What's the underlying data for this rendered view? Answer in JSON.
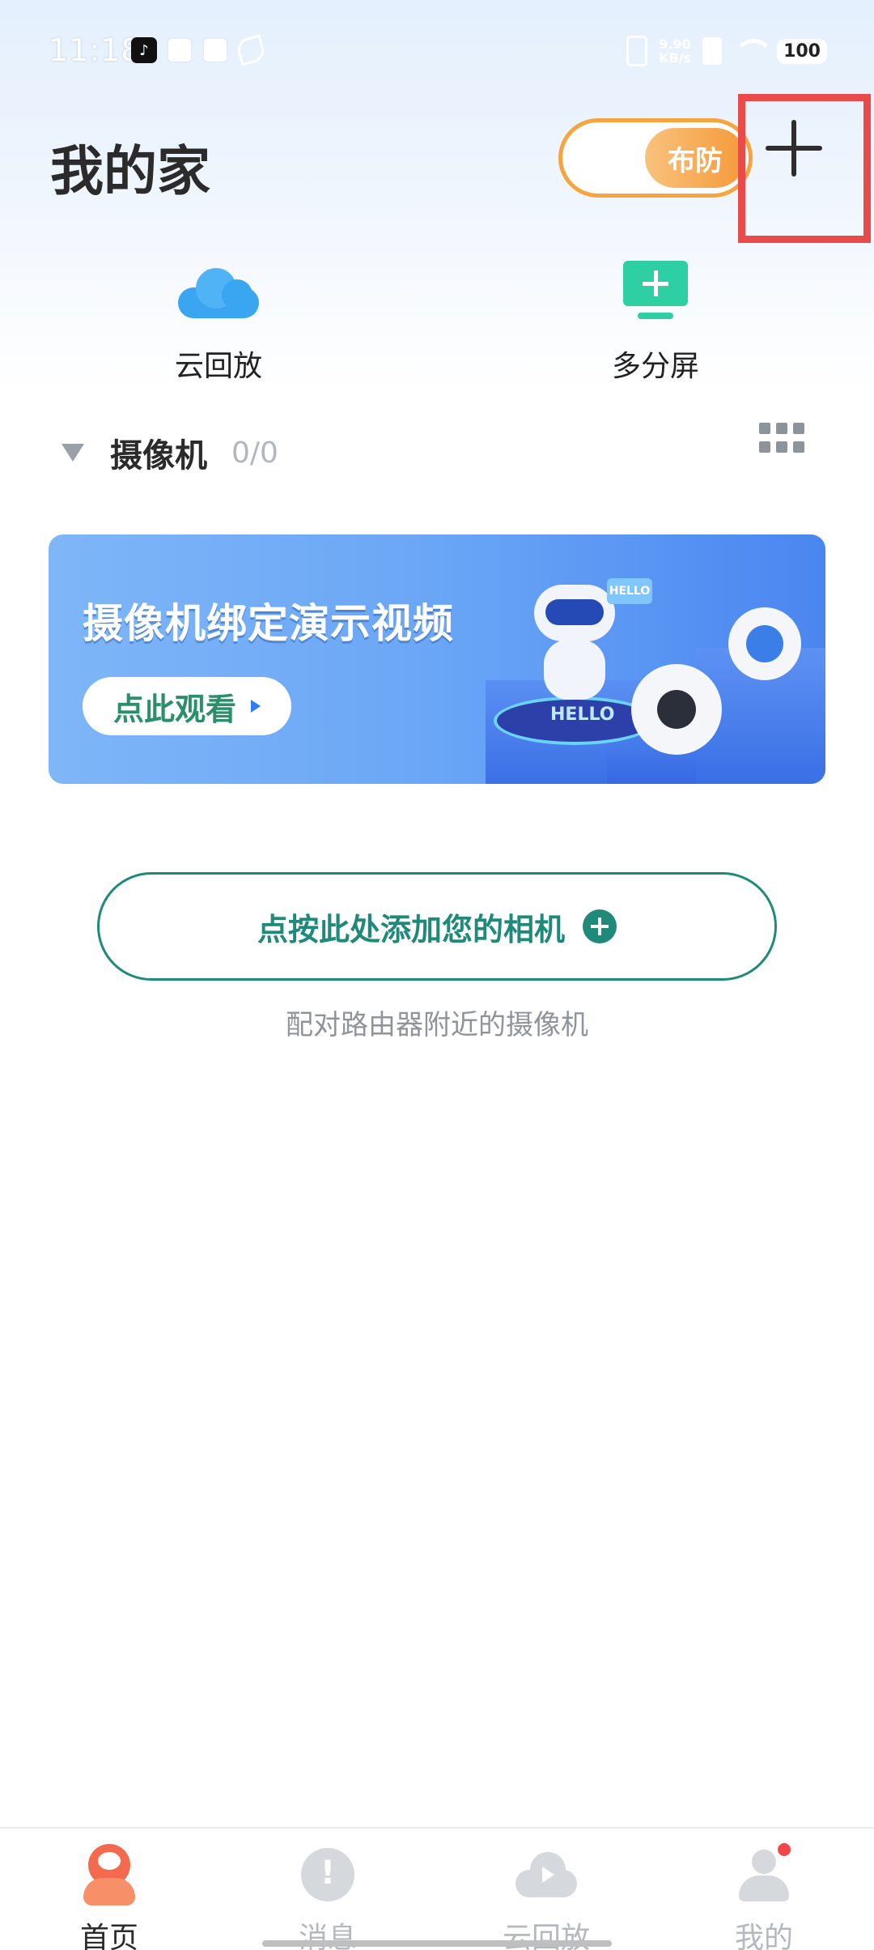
{
  "status_bar": {
    "time": "11:18",
    "net_speed_value": "9.90",
    "net_speed_unit": "KB/s",
    "battery": "100"
  },
  "header": {
    "title": "我的家",
    "arm_label": "布防"
  },
  "quick_actions": [
    {
      "label": "云回放",
      "icon": "cloud-icon"
    },
    {
      "label": "多分屏",
      "icon": "multi-screen-icon"
    }
  ],
  "camera_section": {
    "title": "摄像机",
    "count": "0/0"
  },
  "banner": {
    "title": "摄像机绑定演示视频",
    "button_label": "点此观看",
    "art_text": "HELLO"
  },
  "add_camera": {
    "label": "点按此处添加您的相机",
    "hint": "配对路由器附近的摄像机"
  },
  "bottom_nav": [
    {
      "label": "首页",
      "active": true
    },
    {
      "label": "消息",
      "active": false
    },
    {
      "label": "云回放",
      "active": false
    },
    {
      "label": "我的",
      "active": false
    }
  ],
  "colors": {
    "accent_orange": "#f59a3a",
    "accent_teal": "#1f8a7a",
    "highlight_red": "#e94a4a",
    "cloud_blue": "#3aa6f1",
    "screen_green": "#2fcfa4"
  }
}
